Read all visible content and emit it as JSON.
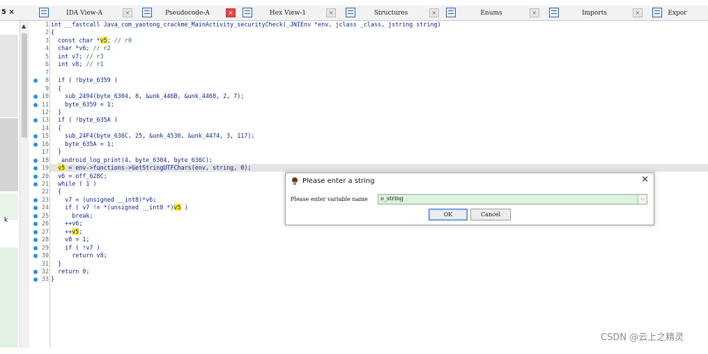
{
  "left_stub": "5  ×",
  "tabs": [
    {
      "label": "IDA View-A",
      "active": false
    },
    {
      "label": "Pseudocode-A",
      "active": true
    },
    {
      "label": "Hex View-1",
      "active": false
    },
    {
      "label": "Structures",
      "active": false
    },
    {
      "label": "Enums",
      "active": false
    },
    {
      "label": "Imports",
      "active": false
    },
    {
      "label": "Expor",
      "active": false
    }
  ],
  "left_panel_text": "k",
  "code_lines": [
    {
      "n": "1",
      "dot": false,
      "html": "int __fastcall Java_com_yaotong_crackme_MainActivity_securityCheck(_JNIEnv *env, jclass _class, jstring string)"
    },
    {
      "n": "2",
      "dot": false,
      "html": "{"
    },
    {
      "n": "3",
      "dot": false,
      "html": "  const char *v5; // r0"
    },
    {
      "n": "4",
      "dot": false,
      "html": "  char *v6; // r2"
    },
    {
      "n": "5",
      "dot": false,
      "html": "  int v7; // r3"
    },
    {
      "n": "6",
      "dot": false,
      "html": "  int v8; // r1"
    },
    {
      "n": "7",
      "dot": false,
      "html": ""
    },
    {
      "n": "8",
      "dot": true,
      "html": "  if ( !byte_6359 )"
    },
    {
      "n": "9",
      "dot": false,
      "html": "  {"
    },
    {
      "n": "10",
      "dot": true,
      "html": "    sub_2494(byte_6304, 8, &unk_446B, &unk_4468, 2, 7);"
    },
    {
      "n": "11",
      "dot": true,
      "html": "    byte_6359 = 1;"
    },
    {
      "n": "12",
      "dot": false,
      "html": "  }"
    },
    {
      "n": "13",
      "dot": true,
      "html": "  if ( !byte_635A )"
    },
    {
      "n": "14",
      "dot": false,
      "html": "  {"
    },
    {
      "n": "15",
      "dot": true,
      "html": "    sub_24F4(byte_636C, 25, &unk_4530, &unk_4474, 3, 117);"
    },
    {
      "n": "16",
      "dot": true,
      "html": "    byte_635A = 1;"
    },
    {
      "n": "17",
      "dot": false,
      "html": "  }"
    },
    {
      "n": "18",
      "dot": true,
      "html": "  _android_log_print(4, byte_6304, byte_636C);"
    },
    {
      "n": "19",
      "dot": true,
      "html": "  v5 = env->functions->GetStringUTFChars(env, string, 0);"
    },
    {
      "n": "20",
      "dot": true,
      "html": "  v6 = off_628C;"
    },
    {
      "n": "21",
      "dot": true,
      "html": "  while ( 1 )"
    },
    {
      "n": "22",
      "dot": false,
      "html": "  {"
    },
    {
      "n": "23",
      "dot": true,
      "html": "    v7 = (unsigned __int8)*v6;"
    },
    {
      "n": "24",
      "dot": true,
      "html": "    if ( v7 != *(unsigned __int8 *)v5 )"
    },
    {
      "n": "25",
      "dot": true,
      "html": "      break;"
    },
    {
      "n": "26",
      "dot": true,
      "html": "    ++v6;"
    },
    {
      "n": "27",
      "dot": true,
      "html": "    ++v5;"
    },
    {
      "n": "28",
      "dot": true,
      "html": "    v8 = 1;"
    },
    {
      "n": "29",
      "dot": true,
      "html": "    if ( !v7 )"
    },
    {
      "n": "30",
      "dot": true,
      "html": "      return v8;"
    },
    {
      "n": "31",
      "dot": false,
      "html": "  }"
    },
    {
      "n": "32",
      "dot": true,
      "html": "  return 0;"
    },
    {
      "n": "33",
      "dot": true,
      "html": "}"
    }
  ],
  "dialog": {
    "title": "Please enter a string",
    "close": "✕",
    "label": "Please enter variable name",
    "value": "o_string",
    "ok": "OK",
    "cancel": "Cancel"
  },
  "watermark": "CSDN @云上之精灵",
  "colors": {
    "highlight": "#f6ee2a",
    "dot": "#2a8fe0",
    "code": "#0b1f8c",
    "active_close": "#e04848"
  }
}
